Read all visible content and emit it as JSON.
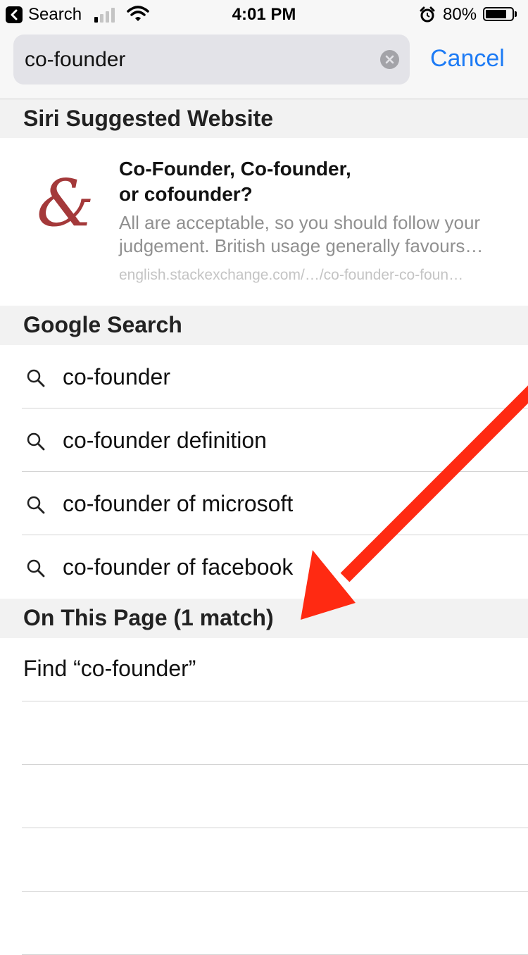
{
  "status_bar": {
    "back_label": "Search",
    "time": "4:01 PM",
    "battery_percent": "80%",
    "battery_level": 0.8,
    "signal_bars_active": 1
  },
  "search": {
    "query": "co-founder",
    "cancel_label": "Cancel"
  },
  "sections": {
    "siri": "Siri Suggested Website",
    "google": "Google Search",
    "on_page": "On This Page (1 match)"
  },
  "siri_suggestion": {
    "title_line1": "Co-Founder, Co-founder,",
    "title_line2": "or cofounder?",
    "description": "All are acceptable, so you should follow your judgement. British usage generally favours…",
    "url": "english.stackexchange.com/…/co-founder-co-foun…",
    "icon": "ampersand-icon",
    "icon_glyph": "&",
    "icon_color": "#a4393a"
  },
  "google_suggestions": [
    "co-founder",
    "co-founder definition",
    "co-founder of microsoft",
    "co-founder of facebook"
  ],
  "find_on_page": "Find “co-founder”",
  "colors": {
    "accent": "#1d7bf5",
    "annotation_arrow": "#ff2a12"
  }
}
